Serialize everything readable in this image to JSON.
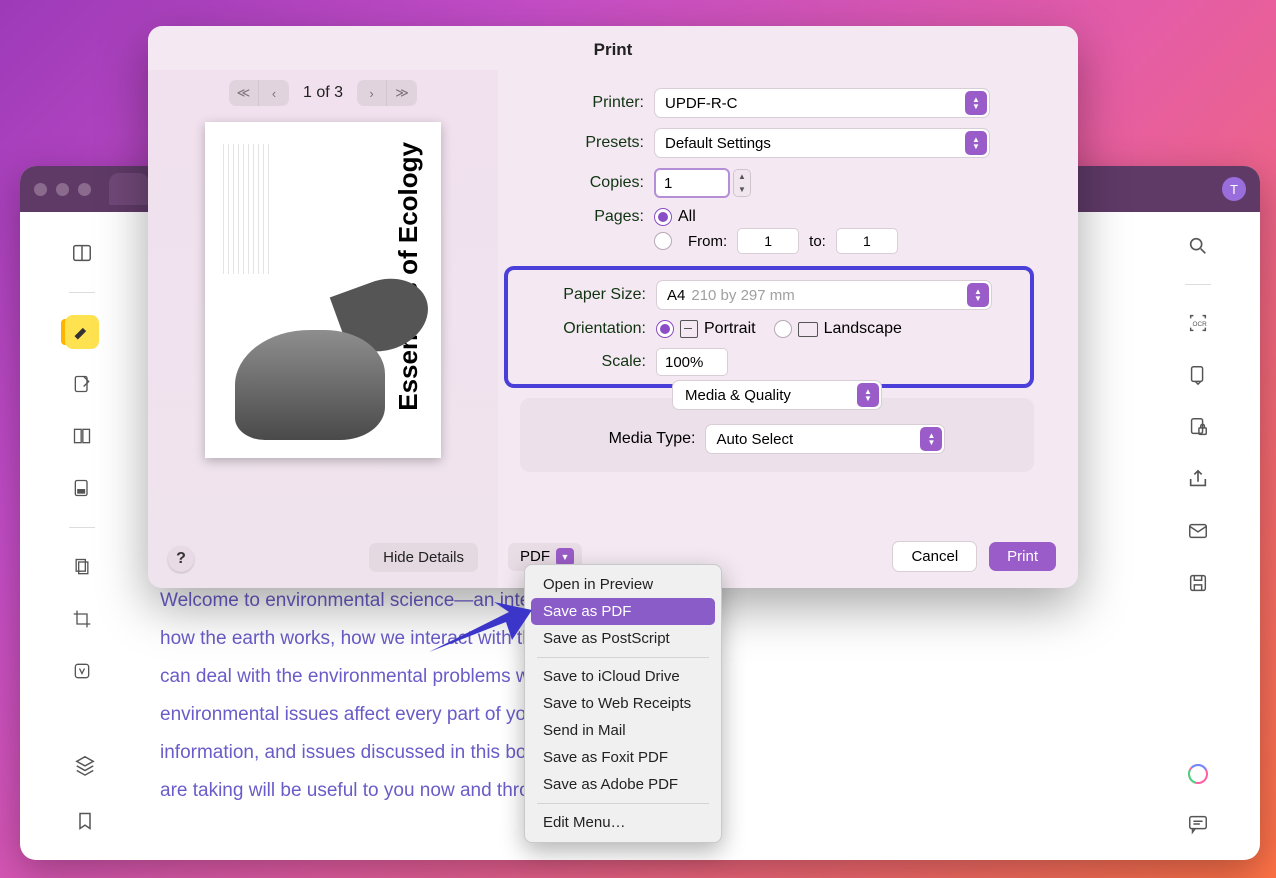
{
  "dialog": {
    "title": "Print",
    "preview": {
      "page_counter": "1 of 3",
      "doc_title": "Essentials of Ecology"
    },
    "help_tooltip": "?",
    "hide_details": "Hide Details",
    "form": {
      "printer_label": "Printer:",
      "printer_value": "UPDF-R-C",
      "presets_label": "Presets:",
      "presets_value": "Default Settings",
      "copies_label": "Copies:",
      "copies_value": "1",
      "pages_label": "Pages:",
      "pages_all": "All",
      "pages_from_label": "From:",
      "pages_from_value": "1",
      "pages_to_label": "to:",
      "pages_to_value": "1",
      "paper_size_label": "Paper Size:",
      "paper_size_value": "A4",
      "paper_size_dim": "210 by 297 mm",
      "orientation_label": "Orientation:",
      "orientation_portrait": "Portrait",
      "orientation_landscape": "Landscape",
      "scale_label": "Scale:",
      "scale_value": "100%",
      "section_value": "Media & Quality",
      "media_type_label": "Media Type:",
      "media_type_value": "Auto Select"
    },
    "footer": {
      "pdf_label": "PDF",
      "cancel": "Cancel",
      "print": "Print"
    },
    "pdf_menu": {
      "open_preview": "Open in Preview",
      "save_pdf": "Save as PDF",
      "save_postscript": "Save as PostScript",
      "save_icloud": "Save to iCloud Drive",
      "save_web_receipts": "Save to Web Receipts",
      "send_mail": "Send in Mail",
      "save_foxit": "Save as Foxit PDF",
      "save_adobe": "Save as Adobe PDF",
      "edit_menu": "Edit Menu…"
    }
  },
  "app": {
    "avatar_initial": "T",
    "doc_text": "Welcome to environmental science—an interdisciplinary study of how the earth works, how we interact with the earth, and how we can deal with the environmental problems we face. Because environmental issues affect every part of your life, the concepts, information, and issues discussed in this book and the course you are taking will be useful to you now and throughout"
  }
}
